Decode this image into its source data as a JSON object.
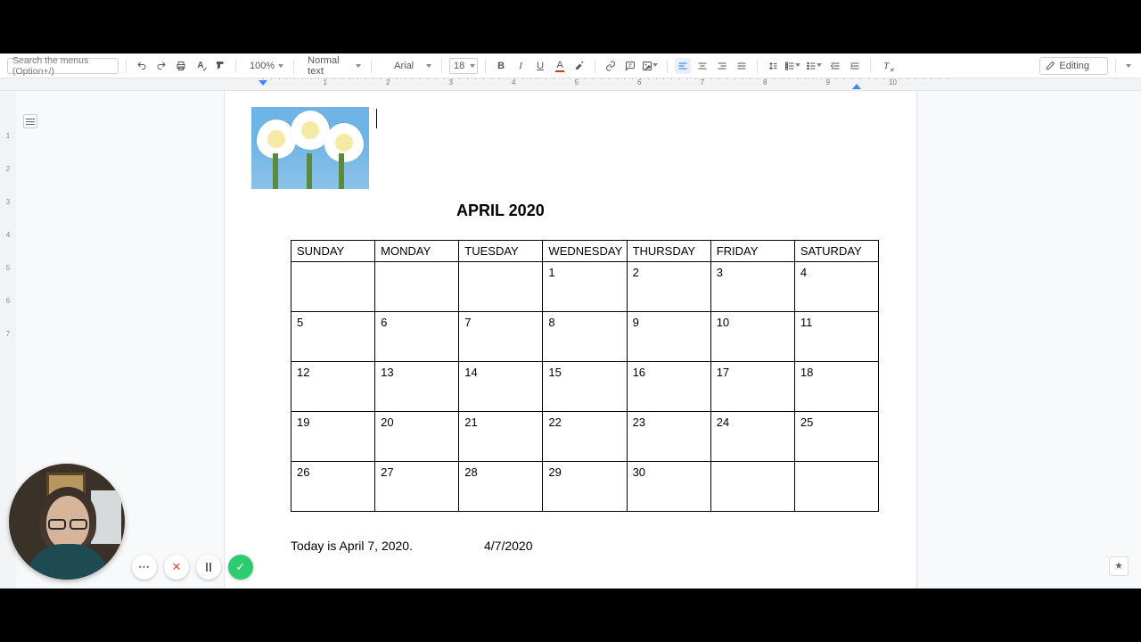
{
  "toolbar": {
    "search_placeholder": "Search the menus (Option+/)",
    "zoom": "100%",
    "style": "Normal text",
    "font": "Arial",
    "font_size": "18",
    "editing_label": "Editing"
  },
  "ruler": {
    "inches": [
      "",
      "1",
      "2",
      "3",
      "4",
      "5",
      "6",
      "7",
      "8",
      "9",
      "10"
    ]
  },
  "document": {
    "title": "APRIL 2020",
    "footer_text": "Today is April 7, 2020.",
    "footer_date_short": "4/7/2020"
  },
  "calendar": {
    "headers": [
      "SUNDAY",
      "MONDAY",
      "TUESDAY",
      "WEDNESDAY",
      "THURSDAY",
      "FRIDAY",
      "SATURDAY"
    ],
    "rows": [
      [
        "",
        "",
        "",
        "1",
        "2",
        "3",
        "4"
      ],
      [
        "5",
        "6",
        "7",
        "8",
        "9",
        "10",
        "11"
      ],
      [
        "12",
        "13",
        "14",
        "15",
        "16",
        "17",
        "18"
      ],
      [
        "19",
        "20",
        "21",
        "22",
        "23",
        "24",
        "25"
      ],
      [
        "26",
        "27",
        "28",
        "29",
        "30",
        "",
        ""
      ]
    ]
  },
  "left_ruler": [
    "",
    "1",
    "2",
    "3",
    "4",
    "5",
    "6",
    "7"
  ]
}
